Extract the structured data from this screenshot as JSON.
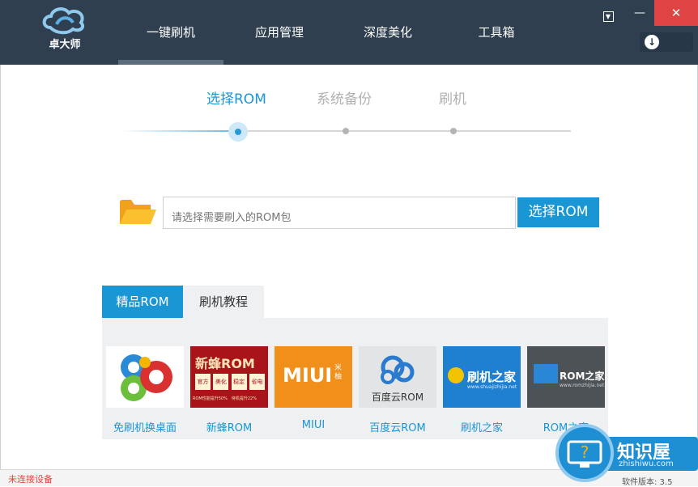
{
  "app": {
    "logo_text": "卓大师"
  },
  "nav": {
    "tabs": [
      "一键刷机",
      "应用管理",
      "深度美化",
      "工具箱"
    ],
    "active_index": 0
  },
  "window_controls": {
    "menu": "▼",
    "minimize": "—",
    "close": "✕"
  },
  "download_icon": "download-icon",
  "steps": [
    "选择ROM",
    "系统备份",
    "刷机"
  ],
  "rom_input": {
    "placeholder": "请选择需要刷入的ROM包"
  },
  "select_button": "选择ROM",
  "tabs": [
    "精品ROM",
    "刷机教程"
  ],
  "tiles": [
    {
      "label": "免刷机换桌面",
      "image": "go-launcher-logo"
    },
    {
      "label": "新蜂ROM",
      "image": "xinfeng-rom-logo",
      "title": "新蜂ROM",
      "icons": [
        "官方",
        "美化",
        "稳定",
        "省电"
      ],
      "caption": "ROM性能提升50%　待机提升22%"
    },
    {
      "label": "MIUI",
      "image": "miui-logo",
      "title": "MIUI",
      "sub": "米柚"
    },
    {
      "label": "百度云ROM",
      "image": "baidu-cloud-rom-logo",
      "title": "百度云ROM"
    },
    {
      "label": "刷机之家",
      "image": "shuajizhijia-logo",
      "title": "刷机之家",
      "caption": "www.shuajizhijia.net"
    },
    {
      "label": "ROM之家",
      "image": "romzhijia-logo",
      "title": "ROM之家",
      "caption": "www.romzhijia.net"
    }
  ],
  "status": {
    "text": "未连接设备"
  },
  "watermark": {
    "title": "知识屋",
    "sub": "zhishiwu.com",
    "footer": "软件版本: 3.5"
  },
  "colors": {
    "header": "#2f3f50",
    "accent": "#1a96d4",
    "status_error": "#e0463a"
  }
}
